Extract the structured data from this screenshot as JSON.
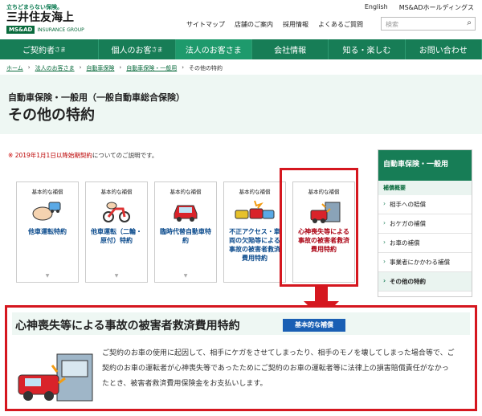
{
  "header": {
    "tagline": "立ちどまらない保険。",
    "company_name": "三井住友海上",
    "brand_badge": "MS&AD",
    "brand_group": "INSURANCE GROUP",
    "lang_link": "English",
    "group_link": "MS&ADホールディングス",
    "util_links": [
      "サイトマップ",
      "店舗のご案内",
      "採用情報",
      "よくあるご質問"
    ],
    "search_placeholder": "検索",
    "search_icon": "magnifier-icon"
  },
  "nav": {
    "items": [
      {
        "label": "ご契約者",
        "suffix": "さま"
      },
      {
        "label": "個人のお客",
        "suffix": "さま"
      },
      {
        "label": "法人のお客さま",
        "suffix": ""
      },
      {
        "label": "会社情報",
        "suffix": ""
      },
      {
        "label": "知る・楽しむ",
        "suffix": ""
      },
      {
        "label": "お問い合わせ",
        "suffix": ""
      }
    ]
  },
  "breadcrumb": [
    "ホーム",
    "法人のお客さま",
    "自動車保険",
    "自動車保険・一般用",
    "その他の特約"
  ],
  "hero": {
    "subtitle": "自動車保険・一般用（一般自動車総合保険）",
    "title": "その他の特約"
  },
  "note": {
    "mark": "※",
    "highlight": "2019年1月1日以降始期契約",
    "text": "についてのご説明です。"
  },
  "cards": [
    {
      "category": "基本的な補償",
      "label": "他車運転特約",
      "icon": "hand-car-icon"
    },
    {
      "category": "基本的な補償",
      "label": "他車運転（二輪・原付）特約",
      "icon": "motorbike-icon"
    },
    {
      "category": "基本的な補償",
      "label": "臨時代替自動車特約",
      "icon": "red-car-icon"
    },
    {
      "category": "基本的な補償",
      "label": "不正アクセス・車両の欠陥等による事故の被害者救済費用特約",
      "icon": "accident-icon"
    },
    {
      "category": "基本的な補償",
      "label": "心神喪失等による事故の被害者救済費用特約",
      "icon": "crash-icon"
    }
  ],
  "sidebar": {
    "header": "自動車保険・一般用",
    "section": "補償概要",
    "items": [
      "相手への賠償",
      "おケガの補償",
      "お車の補償",
      "事業者にかかわる補償",
      "その他の特約"
    ]
  },
  "detail": {
    "title": "心神喪失等による事故の被害者救済費用特約",
    "badge": "基本的な補償",
    "description": "ご契約のお車の使用に起因して、相手にケガをさせてしまったり、相手のモノを壊してしまった場合等で、ご契約のお車の運転者が心神喪失等であったためにご契約のお車の運転者等に法律上の損害賠償責任がなかったとき、被害者救済費用保険金をお支払いします。"
  },
  "colors": {
    "brand_green": "#177d56",
    "highlight_red": "#d5171f",
    "badge_blue": "#1a5fb4"
  }
}
